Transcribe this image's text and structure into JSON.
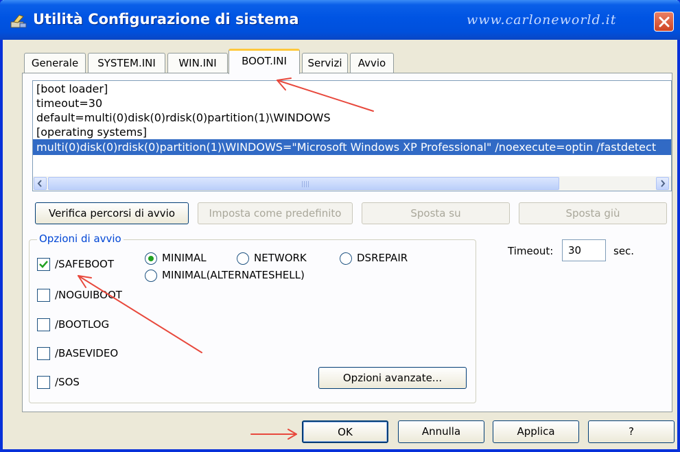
{
  "window": {
    "title": "Utilità Configurazione di sistema",
    "watermark": "www.carloneworld.it"
  },
  "tabs": [
    {
      "label": "Generale"
    },
    {
      "label": "SYSTEM.INI"
    },
    {
      "label": "WIN.INI"
    },
    {
      "label": "BOOT.INI",
      "active": true
    },
    {
      "label": "Servizi"
    },
    {
      "label": "Avvio"
    }
  ],
  "boot_ini": {
    "lines": [
      "[boot loader]",
      "timeout=30",
      "default=multi(0)disk(0)rdisk(0)partition(1)\\WINDOWS",
      "[operating systems]",
      "multi(0)disk(0)rdisk(0)partition(1)\\WINDOWS=\"Microsoft Windows XP Professional\" /noexecute=optin /fastdetect"
    ],
    "selected_index": 4
  },
  "actions": {
    "verify_paths": "Verifica percorsi di avvio",
    "set_default": "Imposta come predefinito",
    "move_up": "Sposta su",
    "move_down": "Sposta giù"
  },
  "boot_options": {
    "group_title": "Opzioni di avvio",
    "safeboot": {
      "label": "/SAFEBOOT",
      "checked": true
    },
    "safeboot_modes": [
      {
        "label": "MINIMAL",
        "selected": true
      },
      {
        "label": "NETWORK",
        "selected": false
      },
      {
        "label": "DSREPAIR",
        "selected": false
      },
      {
        "label": "MINIMAL(ALTERNATESHELL)",
        "selected": false
      }
    ],
    "noguiboot": {
      "label": "/NOGUIBOOT",
      "checked": false
    },
    "bootlog": {
      "label": "/BOOTLOG",
      "checked": false
    },
    "basevideo": {
      "label": "/BASEVIDEO",
      "checked": false
    },
    "sos": {
      "label": "/SOS",
      "checked": false
    },
    "advanced_button": "Opzioni avanzate..."
  },
  "timeout": {
    "label": "Timeout:",
    "value": "30",
    "unit": "sec."
  },
  "dialog_buttons": {
    "ok": "OK",
    "cancel": "Annulla",
    "apply": "Applica",
    "help": "?"
  },
  "colors": {
    "titlebar": "#0054e3",
    "selection": "#316ac5",
    "annotation_arrow": "#e8483c",
    "tab_highlight": "#ffc83c"
  }
}
